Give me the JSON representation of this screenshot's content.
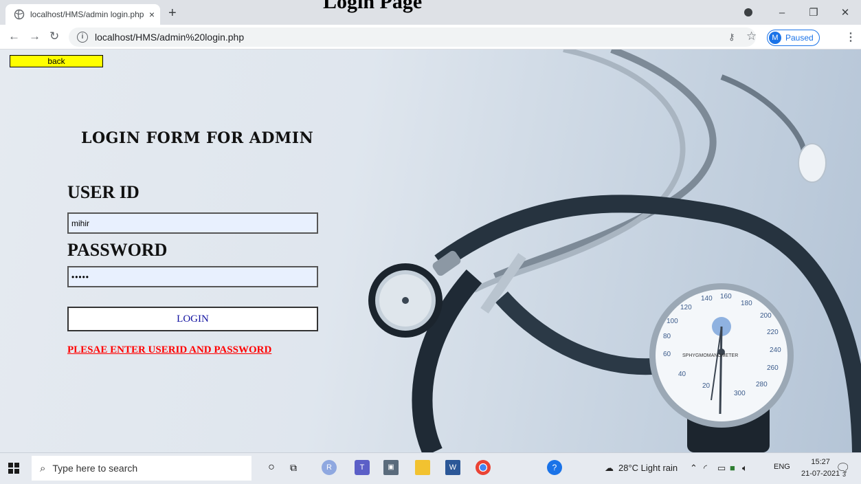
{
  "browser": {
    "tab_title": "localhost/HMS/admin login.php",
    "tab_close": "×",
    "new_tab": "+",
    "overflow_title": "Login Page",
    "url": "localhost/HMS/admin%20login.php",
    "profile_initial": "M",
    "profile_status": "Paused",
    "icons": [
      "back-icon",
      "forward-icon",
      "reload-icon",
      "info-icon",
      "key-icon",
      "star-icon",
      "menu-icon"
    ]
  },
  "page": {
    "back_label": "back",
    "title": "LOGIN FORM FOR ADMIN",
    "user_id_label": "USER ID",
    "user_id_value": "mihir",
    "password_label": "PASSWORD",
    "password_value": "•••••",
    "login_label": "LOGIN",
    "error_message": "PLESAE ENTER USERID AND PASSWORD",
    "gauge_numbers": [
      "20",
      "40",
      "60",
      "80",
      "100",
      "120",
      "140",
      "160",
      "180",
      "200",
      "220",
      "240",
      "260",
      "280",
      "300"
    ],
    "gauge_text": "SPHYGMOMANOMETER",
    "colors": {
      "back_button": "#ffff00",
      "error": "#ff0000",
      "login_text": "#1010a0",
      "input_bg": "#e8f0fe"
    }
  },
  "taskbar": {
    "search_placeholder": "Type here to search",
    "weather": "28°C  Light rain",
    "language": "ENG",
    "time": "15:27",
    "date": "21-07-2021",
    "notification_count": "3",
    "apps": [
      "cortana-icon",
      "task-view-icon",
      "r-app-icon",
      "teams-icon",
      "media-icon",
      "file-explorer-icon",
      "word-icon",
      "chrome-icon",
      "help-icon"
    ]
  }
}
